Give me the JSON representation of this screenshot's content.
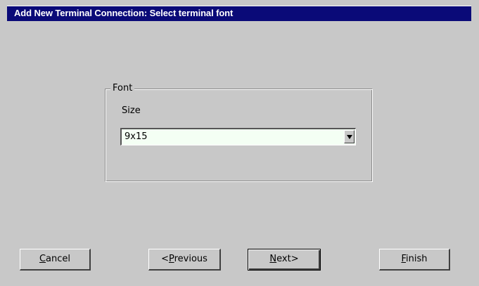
{
  "window": {
    "title": "Add New Terminal Connection: Select terminal font"
  },
  "font_group": {
    "legend": "Font",
    "size_label": "Size",
    "size_value": "9x15"
  },
  "buttons": {
    "cancel": {
      "mnemonic": "C",
      "rest": "ancel"
    },
    "previous": {
      "prefix": "<",
      "mnemonic": "P",
      "rest": "revious"
    },
    "next": {
      "mnemonic": "N",
      "rest": "ext>"
    },
    "finish": {
      "mnemonic": "F",
      "rest": "inish"
    }
  },
  "icons": {
    "dropdown_arrow": "chevron-down-icon"
  },
  "colors": {
    "titlebar": "#0a0a78",
    "background": "#c8c8c8",
    "combo_field": "#f4fff4"
  }
}
